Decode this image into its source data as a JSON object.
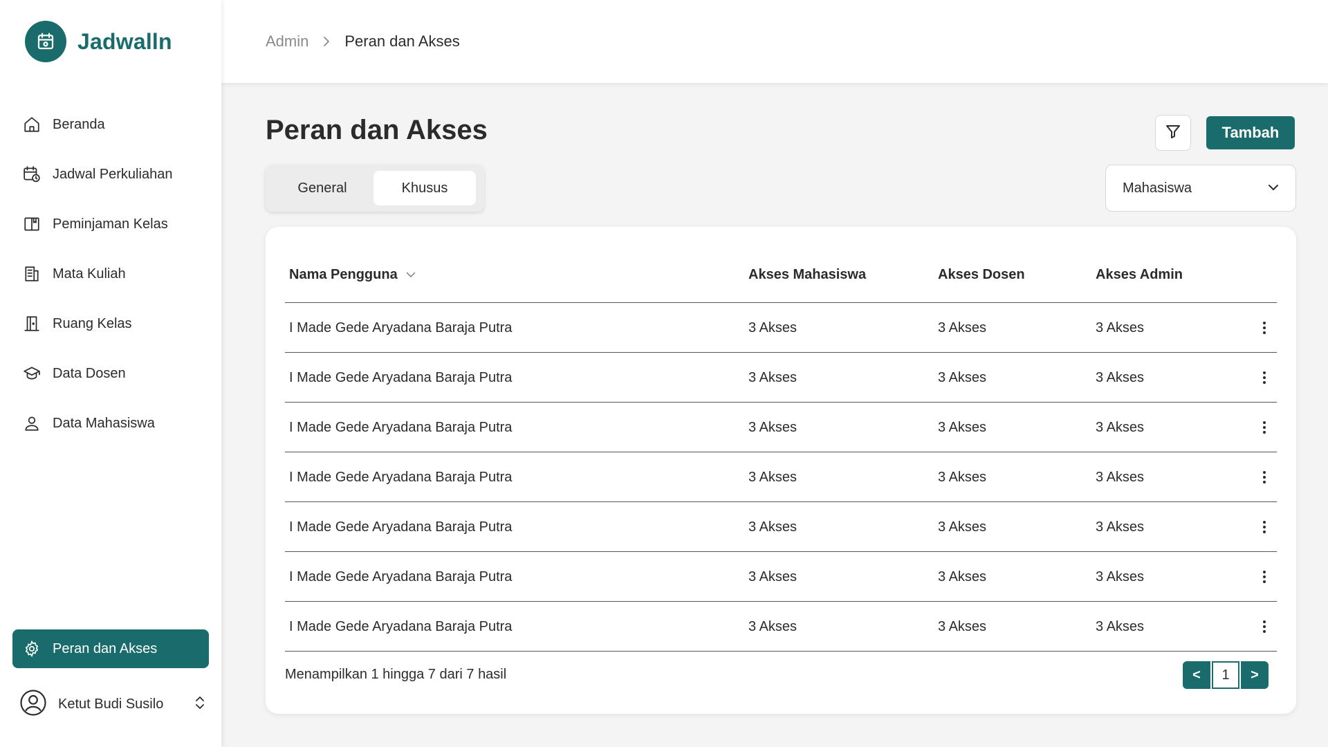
{
  "app": {
    "name": "Jadwalln",
    "accent_color": "#1a6b6b"
  },
  "sidebar": {
    "items": [
      {
        "label": "Beranda",
        "icon": "home-icon"
      },
      {
        "label": "Jadwal Perkuliahan",
        "icon": "calendar-clock-icon"
      },
      {
        "label": "Peminjaman Kelas",
        "icon": "book-open-icon"
      },
      {
        "label": "Mata Kuliah",
        "icon": "document-list-icon"
      },
      {
        "label": "Ruang Kelas",
        "icon": "door-icon"
      },
      {
        "label": "Data Dosen",
        "icon": "graduation-cap-icon"
      },
      {
        "label": "Data Mahasiswa",
        "icon": "user-icon"
      }
    ],
    "active_item": {
      "label": "Peran dan Akses",
      "icon": "gear-icon"
    },
    "user": {
      "name": "Ketut Budi Susilo"
    }
  },
  "breadcrumb": {
    "parent": "Admin",
    "current": "Peran dan Akses"
  },
  "main": {
    "title": "Peran dan Akses",
    "add_label": "Tambah",
    "tabs": [
      {
        "label": "General",
        "active": false
      },
      {
        "label": "Khusus",
        "active": true
      }
    ],
    "select": {
      "value": "Mahasiswa"
    }
  },
  "table": {
    "columns": [
      "Nama Pengguna",
      "Akses Mahasiswa",
      "Akses Dosen",
      "Akses Admin"
    ],
    "rows": [
      [
        "I Made Gede Aryadana Baraja Putra",
        "3 Akses",
        "3 Akses",
        "3 Akses"
      ],
      [
        "I Made Gede Aryadana Baraja Putra",
        "3 Akses",
        "3 Akses",
        "3 Akses"
      ],
      [
        "I Made Gede Aryadana Baraja Putra",
        "3 Akses",
        "3 Akses",
        "3 Akses"
      ],
      [
        "I Made Gede Aryadana Baraja Putra",
        "3 Akses",
        "3 Akses",
        "3 Akses"
      ],
      [
        "I Made Gede Aryadana Baraja Putra",
        "3 Akses",
        "3 Akses",
        "3 Akses"
      ],
      [
        "I Made Gede Aryadana Baraja Putra",
        "3 Akses",
        "3 Akses",
        "3 Akses"
      ],
      [
        "I Made Gede Aryadana Baraja Putra",
        "3 Akses",
        "3 Akses",
        "3 Akses"
      ]
    ],
    "summary": "Menampilkan 1 hingga 7 dari 7 hasil",
    "pagination": {
      "prev": "<",
      "page": "1",
      "next": ">"
    }
  }
}
